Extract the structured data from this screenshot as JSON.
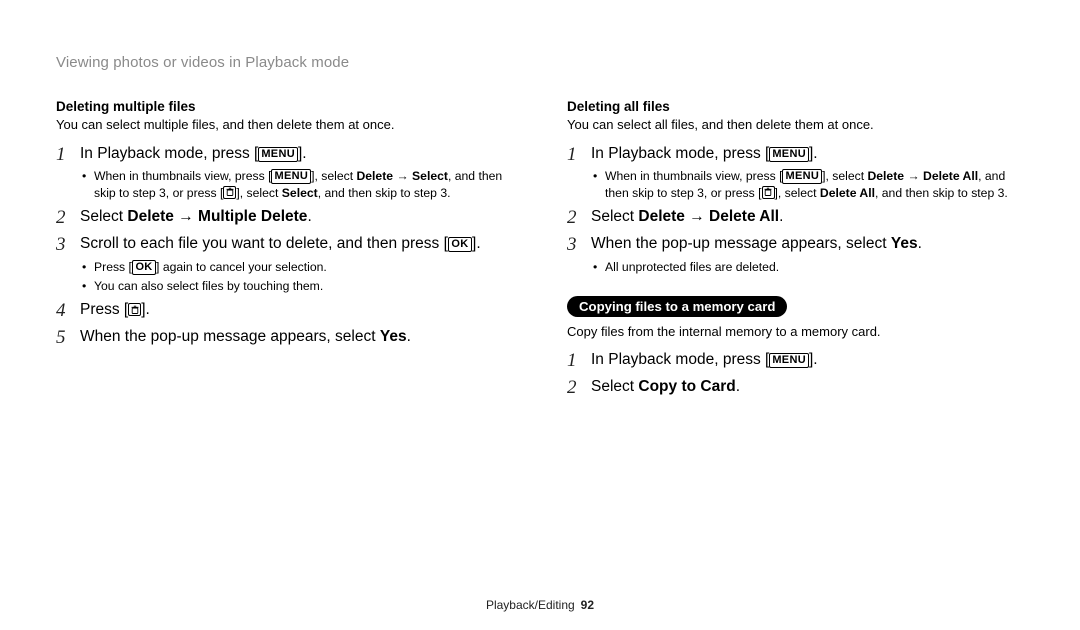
{
  "header": "Viewing photos or videos in Playback mode",
  "icons": {
    "menu": "MENU",
    "ok": "OK"
  },
  "left": {
    "title": "Deleting multiple files",
    "sub": "You can select multiple files, and then delete them at once.",
    "s1a": "In Playback mode, press [",
    "s1b": "].",
    "n1a": "When in thumbnails view, press [",
    "n1b": "], select ",
    "n1c": "Delete",
    "n1arrow": " → ",
    "n1d": "Select",
    "n1e": ", and then skip to step 3, or press [",
    "n1f": "], select ",
    "n1g": "Select",
    "n1h": ", and then skip to step 3.",
    "s2a": "Select ",
    "s2b": "Delete",
    "s2arrow": " → ",
    "s2c": "Multiple Delete",
    "s2d": ".",
    "s3a": "Scroll to each file you want to delete, and then press [",
    "s3b": "].",
    "n3a": "Press [",
    "n3b": "] again to cancel your selection.",
    "n3c": "You can also select files by touching them.",
    "s4a": "Press [",
    "s4b": "].",
    "s5a": "When the pop-up message appears, select ",
    "s5b": "Yes",
    "s5c": "."
  },
  "right": {
    "title": "Deleting all files",
    "sub": "You can select all files, and then delete them at once.",
    "s1a": "In Playback mode, press [",
    "s1b": "].",
    "n1a": "When in thumbnails view, press [",
    "n1b": "], select ",
    "n1c": "Delete",
    "n1arrow": " → ",
    "n1d": "Delete All",
    "n1e": ", and then skip to step 3, or press [",
    "n1f": "], select ",
    "n1g": "Delete All",
    "n1h": ", and then skip to step 3.",
    "s2a": "Select ",
    "s2b": "Delete",
    "s2arrow": " → ",
    "s2c": "Delete All",
    "s2d": ".",
    "s3a": "When the pop-up message appears, select ",
    "s3b": "Yes",
    "s3c": ".",
    "n3": "All unprotected files are deleted.",
    "pill": "Copying files to a memory card",
    "copy_sub": "Copy files from the internal memory to a memory card.",
    "c1a": "In Playback mode, press [",
    "c1b": "].",
    "c2a": "Select ",
    "c2b": "Copy to Card",
    "c2c": "."
  },
  "footer": {
    "section": "Playback/Editing",
    "page": "92"
  }
}
